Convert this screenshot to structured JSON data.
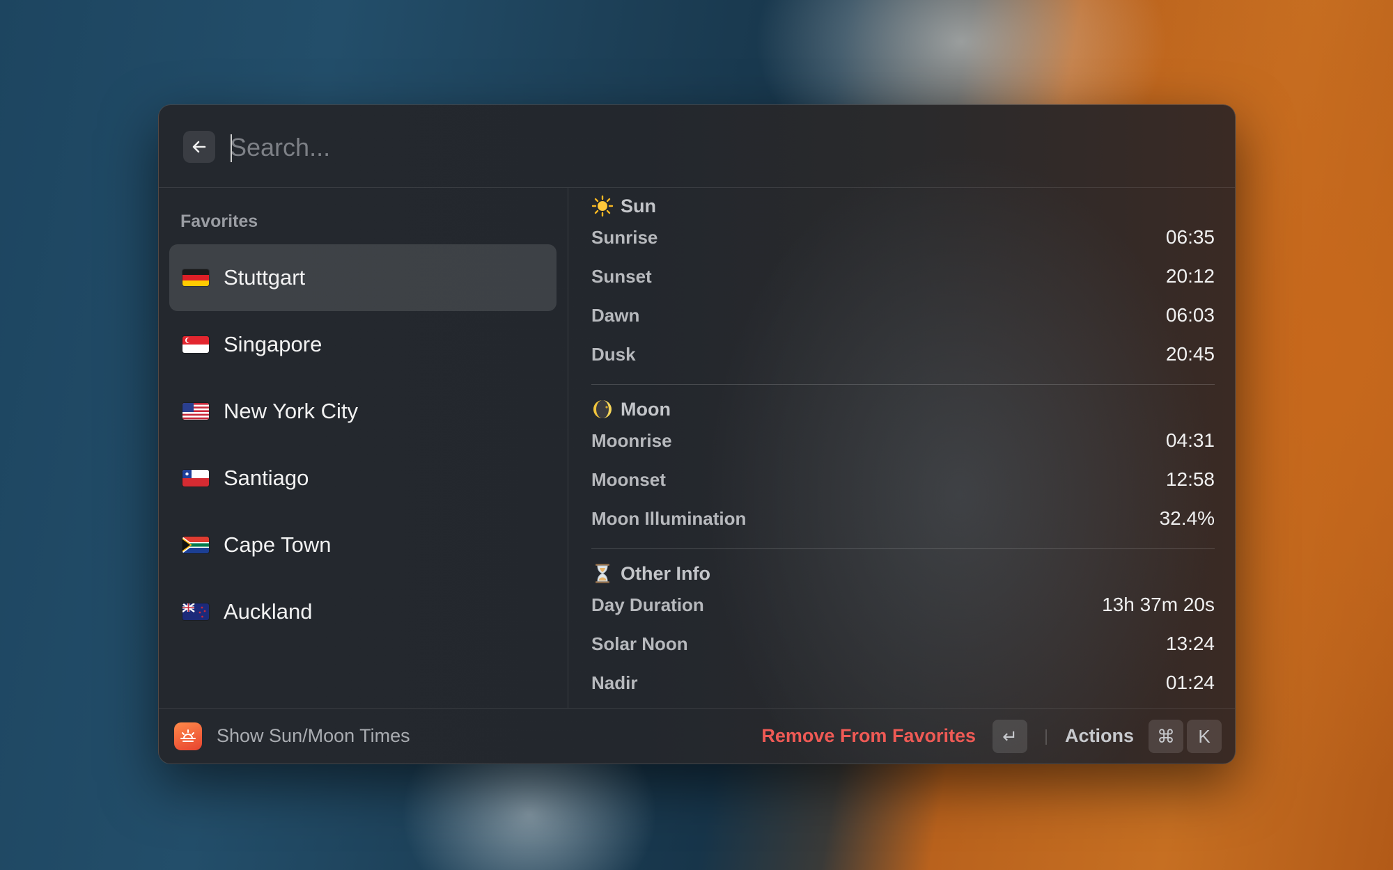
{
  "search": {
    "placeholder": "Search..."
  },
  "sidebar": {
    "section_title": "Favorites",
    "items": [
      {
        "label": "Stuttgart",
        "flag": "germany-flag-icon",
        "selected": true
      },
      {
        "label": "Singapore",
        "flag": "singapore-flag-icon",
        "selected": false
      },
      {
        "label": "New York City",
        "flag": "usa-flag-icon",
        "selected": false
      },
      {
        "label": "Santiago",
        "flag": "chile-flag-icon",
        "selected": false
      },
      {
        "label": "Cape Town",
        "flag": "south-africa-flag-icon",
        "selected": false
      },
      {
        "label": "Auckland",
        "flag": "new-zealand-flag-icon",
        "selected": false
      }
    ]
  },
  "detail": {
    "sun": {
      "title": "Sun",
      "icon": "sun-emoji-icon",
      "rows": [
        {
          "label": "Sunrise",
          "value": "06:35"
        },
        {
          "label": "Sunset",
          "value": "20:12"
        },
        {
          "label": "Dawn",
          "value": "06:03"
        },
        {
          "label": "Dusk",
          "value": "20:45"
        }
      ]
    },
    "moon": {
      "title": "Moon",
      "icon": "moon-emoji-icon",
      "rows": [
        {
          "label": "Moonrise",
          "value": "04:31"
        },
        {
          "label": "Moonset",
          "value": "12:58"
        },
        {
          "label": "Moon Illumination",
          "value": "32.4%"
        }
      ]
    },
    "other": {
      "title": "Other Info",
      "icon": "hourglass-emoji-icon",
      "rows": [
        {
          "label": "Day Duration",
          "value": "13h 37m 20s"
        },
        {
          "label": "Solar Noon",
          "value": "13:24"
        },
        {
          "label": "Nadir",
          "value": "01:24"
        }
      ]
    }
  },
  "footer": {
    "title": "Show Sun/Moon Times",
    "primary_action": "Remove From Favorites",
    "enter_key": "↵",
    "actions_label": "Actions",
    "cmd_key": "⌘",
    "k_key": "K"
  },
  "colors": {
    "destructive": "#ef5a55",
    "app_icon": "#f06a3a"
  }
}
